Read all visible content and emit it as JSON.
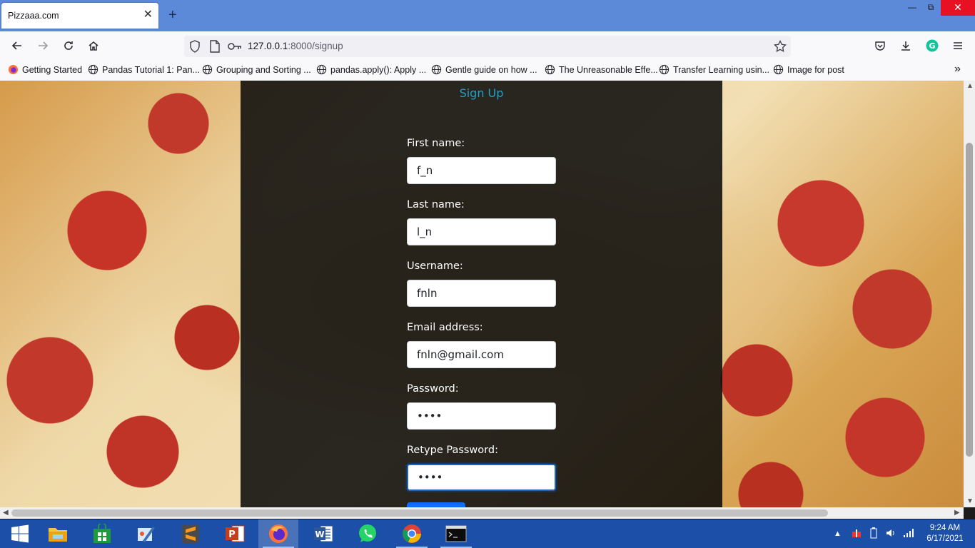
{
  "browser": {
    "tab_title": "Pizzaaa.com",
    "tab_close": "✕",
    "new_tab": "+",
    "url_prefix": "127.0.0.1",
    "url_rest": ":8000/signup",
    "bookmarks": [
      "Getting Started",
      "Pandas Tutorial 1: Pan...",
      "Grouping and Sorting ...",
      "pandas.apply(): Apply ...",
      "Gentle guide on how ...",
      "The Unreasonable Effe...",
      "Transfer Learning usin...",
      "Image for post"
    ]
  },
  "page": {
    "signup_link": "Sign Up",
    "fields": [
      {
        "label": "First name:",
        "value": "f_n"
      },
      {
        "label": "Last name:",
        "value": "l_n"
      },
      {
        "label": "Username:",
        "value": "fnln"
      },
      {
        "label": "Email address:",
        "value": "fnln@gmail.com"
      },
      {
        "label": "Password:",
        "value": "••••"
      },
      {
        "label": "Retype Password:",
        "value": "••••"
      }
    ]
  },
  "taskbar": {
    "time": "9:24 AM",
    "date": "6/17/2021"
  },
  "colors": {
    "titlebar": "#5d8ad8",
    "link": "#1aa2c9",
    "taskbar": "#1c4fa8"
  }
}
